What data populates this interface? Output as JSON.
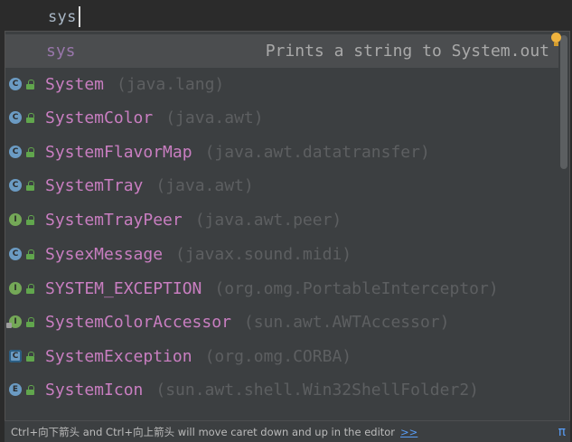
{
  "editor": {
    "typed_text": "sys"
  },
  "popup": {
    "live_template": {
      "name": "sys",
      "description": "Prints a string to System.out"
    },
    "items": [
      {
        "name": "System",
        "package": "(java.lang)",
        "kind": "class",
        "icon": "class-icon"
      },
      {
        "name": "SystemColor",
        "package": "(java.awt)",
        "kind": "class",
        "icon": "class-icon"
      },
      {
        "name": "SystemFlavorMap",
        "package": "(java.awt.datatransfer)",
        "kind": "class",
        "icon": "class-icon"
      },
      {
        "name": "SystemTray",
        "package": "(java.awt)",
        "kind": "class",
        "icon": "class-icon"
      },
      {
        "name": "SystemTrayPeer",
        "package": "(java.awt.peer)",
        "kind": "interface",
        "icon": "interface-icon"
      },
      {
        "name": "SysexMessage",
        "package": "(javax.sound.midi)",
        "kind": "class",
        "icon": "class-icon"
      },
      {
        "name": "SYSTEM_EXCEPTION",
        "package": "(org.omg.PortableInterceptor)",
        "kind": "interface",
        "icon": "interface-icon"
      },
      {
        "name": "SystemColorAccessor",
        "package": "(sun.awt.AWTAccessor)",
        "kind": "interface",
        "icon": "interface-icon"
      },
      {
        "name": "SystemException",
        "package": "(org.omg.CORBA)",
        "kind": "abstract",
        "icon": "abstract-class-icon"
      },
      {
        "name": "SystemIcon",
        "package": "(sun.awt.shell.Win32ShellFolder2)",
        "kind": "enum",
        "icon": "enum-icon"
      }
    ],
    "footer": {
      "hint": "Ctrl+向下箭头 and Ctrl+向上箭头 will move caret down and up in the editor",
      "link": ">>",
      "pi": "π"
    }
  },
  "colors": {
    "background": "#2b2b2b",
    "popup_bg": "#3c3f41",
    "selected_row": "#4b4d4f",
    "item_name": "#c97ec1",
    "package_text": "#5d5f61",
    "link": "#589df6"
  }
}
